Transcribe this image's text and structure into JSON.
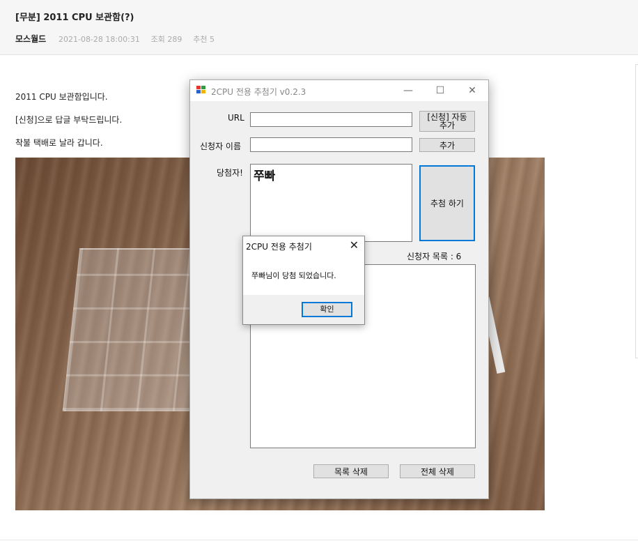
{
  "post": {
    "title": "[무분] 2011 CPU 보관함(?)",
    "author": "모스월드",
    "date": "2021-08-28 18:00:31",
    "views": "조회 289",
    "recommends": "추천 5",
    "body": [
      "2011 CPU 보관함입니다.",
      "[신청]으로 답글 부탁드립니다.",
      "착불 택배로 날라 갑니다."
    ]
  },
  "app": {
    "title": "2CPU 전용 추첨기 v0.2.3",
    "minimize": "—",
    "maximize": "☐",
    "close": "✕",
    "url_label": "URL",
    "url_value": "",
    "auto_add_label": "[신청] 자동\n추가",
    "applicant_label": "신청자 이름",
    "applicant_value": "",
    "add_label": "추가",
    "winner_label": "당첨자!",
    "winner_value": "쭈빠",
    "draw_label": "추첨 하기",
    "list_count_label": "신청자 목록 : 6",
    "delete_list_label": "목록 삭제",
    "delete_all_label": "전체 삭제"
  },
  "dialog": {
    "title": "2CPU 전용 추첨기",
    "close": "✕",
    "message": "쭈빠님이 당첨 되었습니다.",
    "ok_label": "확인"
  }
}
